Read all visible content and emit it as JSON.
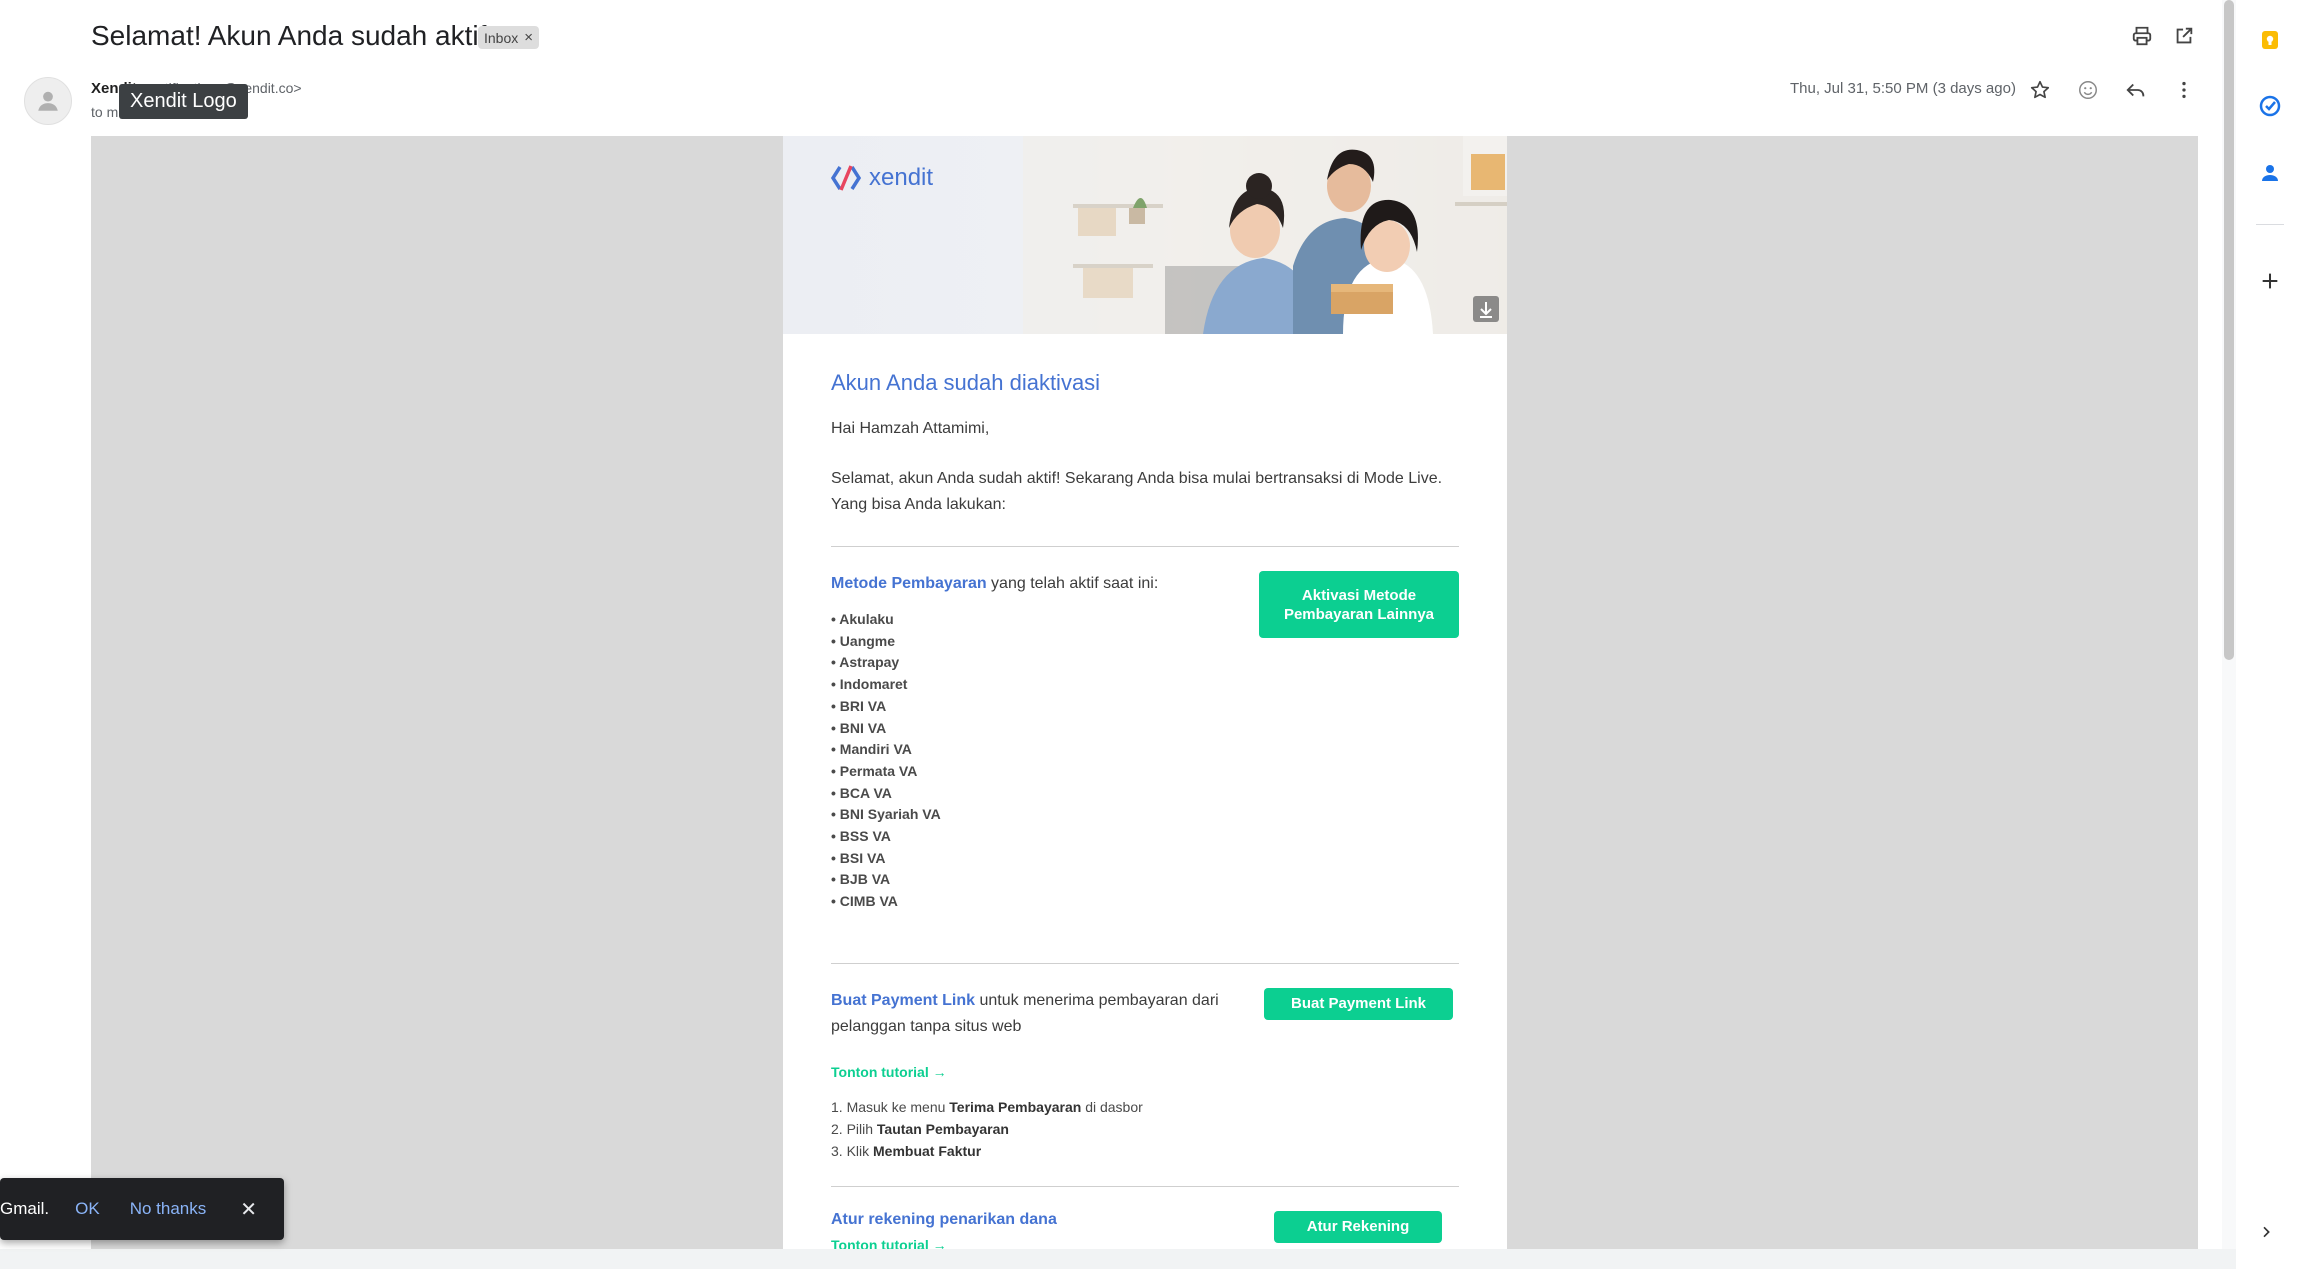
{
  "subject": "Selamat! Akun Anda sudah aktif",
  "label_chip": {
    "text": "Inbox",
    "remove": "×"
  },
  "sender": {
    "name": "Xendit",
    "email": "<notifications@xendit.co>",
    "to": "to m"
  },
  "tooltip": "Xendit Logo",
  "date": "Thu, Jul 31, 5:50 PM (3 days ago)",
  "header_icons": [
    "print-icon",
    "open-in-new-window-icon",
    "star-icon",
    "emoji-icon",
    "reply-icon",
    "more-vert-icon"
  ],
  "brand": {
    "logo_text": "xendit",
    "accent": "#4573d2",
    "green": "#0ccf91"
  },
  "email": {
    "heading": "Akun Anda sudah diaktivasi",
    "greeting": "Hai  Hamzah Attamimi,",
    "intro": "Selamat, akun Anda sudah aktif! Sekarang Anda bisa mulai bertransaksi di Mode Live. Yang bisa Anda lakukan:",
    "payment_methods": {
      "title": "Metode Pembayaran",
      "title_suffix": " yang telah aktif saat ini:",
      "button": "Aktivasi Metode Pembayaran Lainnya",
      "items": [
        "• Akulaku",
        "• Uangme",
        "• Astrapay",
        "• Indomaret",
        "• BRI VA",
        "• BNI VA",
        "• Mandiri VA",
        "• Permata VA",
        "• BCA VA",
        "• BNI Syariah VA",
        "• BSS VA",
        "• BSI VA",
        "• BJB VA",
        "• CIMB VA"
      ]
    },
    "payment_link": {
      "title": "Buat Payment Link",
      "title_suffix": " untuk menerima pembayaran dari pelanggan tanpa situs web",
      "button": "Buat Payment Link",
      "tutorial": "Tonton tutorial →",
      "steps": [
        {
          "prefix": "1. Masuk ke menu ",
          "bold": "Terima Pembayaran",
          "suffix": " di dasbor"
        },
        {
          "prefix": "2. Pilih ",
          "bold": "Tautan Pembayaran",
          "suffix": ""
        },
        {
          "prefix": "3. Klik ",
          "bold": "Membuat Faktur",
          "suffix": ""
        }
      ]
    },
    "rekening": {
      "title": "Atur rekening penarikan dana",
      "button": "Atur Rekening",
      "tutorial": "Tonton tutorial →"
    }
  },
  "snackbar": {
    "text": "Gmail.",
    "ok": "OK",
    "no_thanks": "No thanks",
    "close": "✕"
  },
  "side_panel": [
    "keep-icon",
    "tasks-icon",
    "contacts-icon",
    "add-icon",
    "chevron-right-icon"
  ]
}
